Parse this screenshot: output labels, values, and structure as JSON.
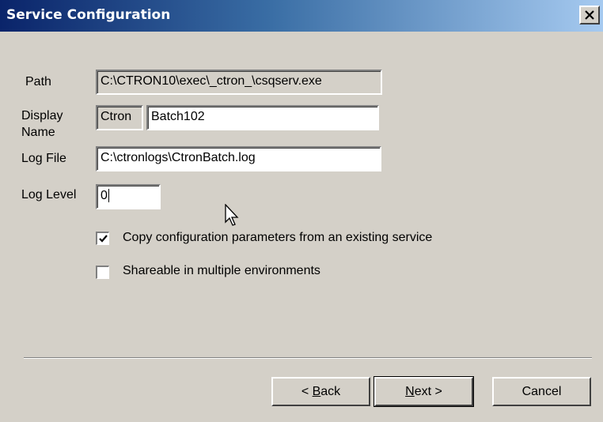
{
  "window": {
    "title": "Service Configuration",
    "close_glyph": "✕"
  },
  "form": {
    "path": {
      "label": "Path",
      "value": "C:\\CTRON10\\exec\\_ctron_\\csqserv.exe"
    },
    "display_name": {
      "label_line1": "Display",
      "label_line2": "Name",
      "prefix": "Ctron",
      "value": "Batch102"
    },
    "log_file": {
      "label": "Log File",
      "value": "C:\\ctronlogs\\CtronBatch.log"
    },
    "log_level": {
      "label": "Log Level",
      "value": "0"
    }
  },
  "options": {
    "copy_config": {
      "label": "Copy configuration parameters from an existing service",
      "checked": true
    },
    "shareable": {
      "label": "Shareable in multiple environments",
      "checked": false
    }
  },
  "buttons": {
    "back": {
      "prefix": "< ",
      "accel": "B",
      "rest": "ack"
    },
    "next": {
      "accel": "N",
      "rest": "ext >"
    },
    "cancel": {
      "label": "Cancel"
    }
  },
  "icons": {
    "close": "close-icon",
    "check": "checkmark-icon",
    "pointer": "mouse-pointer-icon"
  }
}
